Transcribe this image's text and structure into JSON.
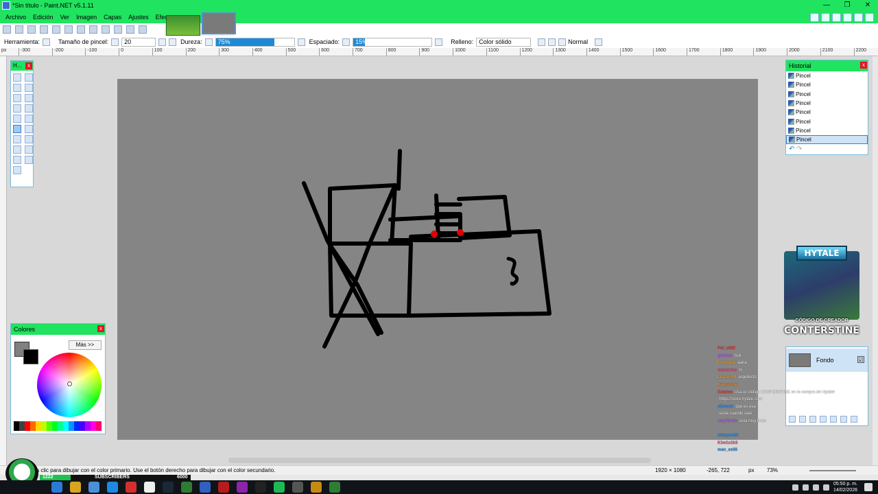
{
  "window": {
    "title": "*Sin título - Paint.NET v5.1.11",
    "controls": [
      "—",
      "❐",
      "✕"
    ]
  },
  "menu": [
    "Archivo",
    "Edición",
    "Ver",
    "Imagen",
    "Capas",
    "Ajustes",
    "Efectos"
  ],
  "toolbar2": {
    "tool_label": "Herramienta:",
    "brush_size_label": "Tamaño de pincel:",
    "brush_size_value": "20",
    "hardness_label": "Dureza:",
    "hardness_value": "75%",
    "hardness_fraction": 0.75,
    "spacing_label": "Espaciado:",
    "spacing_value": "15%",
    "spacing_fraction": 0.15,
    "fill_label": "Relleno:",
    "fill_value": "Color sólido",
    "blend_value": "Normal"
  },
  "ruler_ticks": [
    "-300",
    "-200",
    "-100",
    "0",
    "100",
    "200",
    "300",
    "400",
    "500",
    "600",
    "700",
    "800",
    "900",
    "1000",
    "1100",
    "1200",
    "1300",
    "1400",
    "1500",
    "1600",
    "1700",
    "1800",
    "1900",
    "2000",
    "2100",
    "2200"
  ],
  "ruler_unit": "px",
  "tools_window": {
    "title": "H..."
  },
  "colors_window": {
    "title": "Colores",
    "more_button": "Más >>",
    "primary_color": "#808080",
    "secondary_color": "#000000"
  },
  "history_window": {
    "title": "Historial",
    "items": [
      "Pincel",
      "Pincel",
      "Pincel",
      "Pincel",
      "Pincel",
      "Pincel",
      "Pincel",
      "Pincel"
    ],
    "selected_index": 7
  },
  "promo": {
    "logo": "HYTALE",
    "code_label": "CÓDIGO DE CREADOR",
    "creator": "CONTERSTINE"
  },
  "layers_window": {
    "layer_name": "Fondo",
    "visible": "☑"
  },
  "chat": [
    {
      "user": "Pol_v082",
      "text": "",
      "color": "#ff4a4a"
    },
    {
      "user": "ghfuhts",
      "text": "holi",
      "color": "#c070ff"
    },
    {
      "user": "Extriador",
      "text": "aana",
      "color": "#ffb020"
    },
    {
      "user": "hdsoarias",
      "text": "hi",
      "color": "#ff5a8a"
    },
    {
      "user": "Loazo_44",
      "text": "arquitecto",
      "color": "#ffb020"
    },
    {
      "user": "KapoZone",
      "text": "",
      "color": "#ff9a30"
    },
    {
      "user": "Katolos",
      "text": "Usa el código CONTERSTINE en la compra de Hytale!",
      "color": "#ff4a4a"
    },
    {
      "user": "",
      "text": "https://store.hytale.com",
      "color": "#ffffff"
    },
    {
      "user": "alfreado",
      "text": "que es esa",
      "color": "#3aa0ff"
    },
    {
      "user": "",
      "text": "esne cuando sale",
      "color": "#20c050"
    },
    {
      "user": "wayfilodie",
      "text": "esta muy lindo",
      "color": "#c070ff"
    },
    {
      "user": "",
      "text": "",
      "color": "#ffb020"
    },
    {
      "user": "fridayoo56",
      "text": "",
      "color": "#3aa0ff"
    },
    {
      "user": "K1w1s1h3",
      "text": "",
      "color": "#ff5a8a"
    },
    {
      "user": "man_es56",
      "text": "",
      "color": "#3aa0ff"
    }
  ],
  "status": {
    "message": "Haga clic para dibujar con el color primario. Use el botón derecho para dibujar con el color secundario.",
    "image_size": "1920 × 1080",
    "cursor": "-265, 722",
    "unit": "px",
    "zoom": "73%"
  },
  "overlay_bar": {
    "current": "1222",
    "label": "SUBSCRIBERS",
    "goal": "6000",
    "progress_fraction": 0.2037
  },
  "taskbar": {
    "time": "05:50 p. m.",
    "date": "14/02/2026"
  }
}
